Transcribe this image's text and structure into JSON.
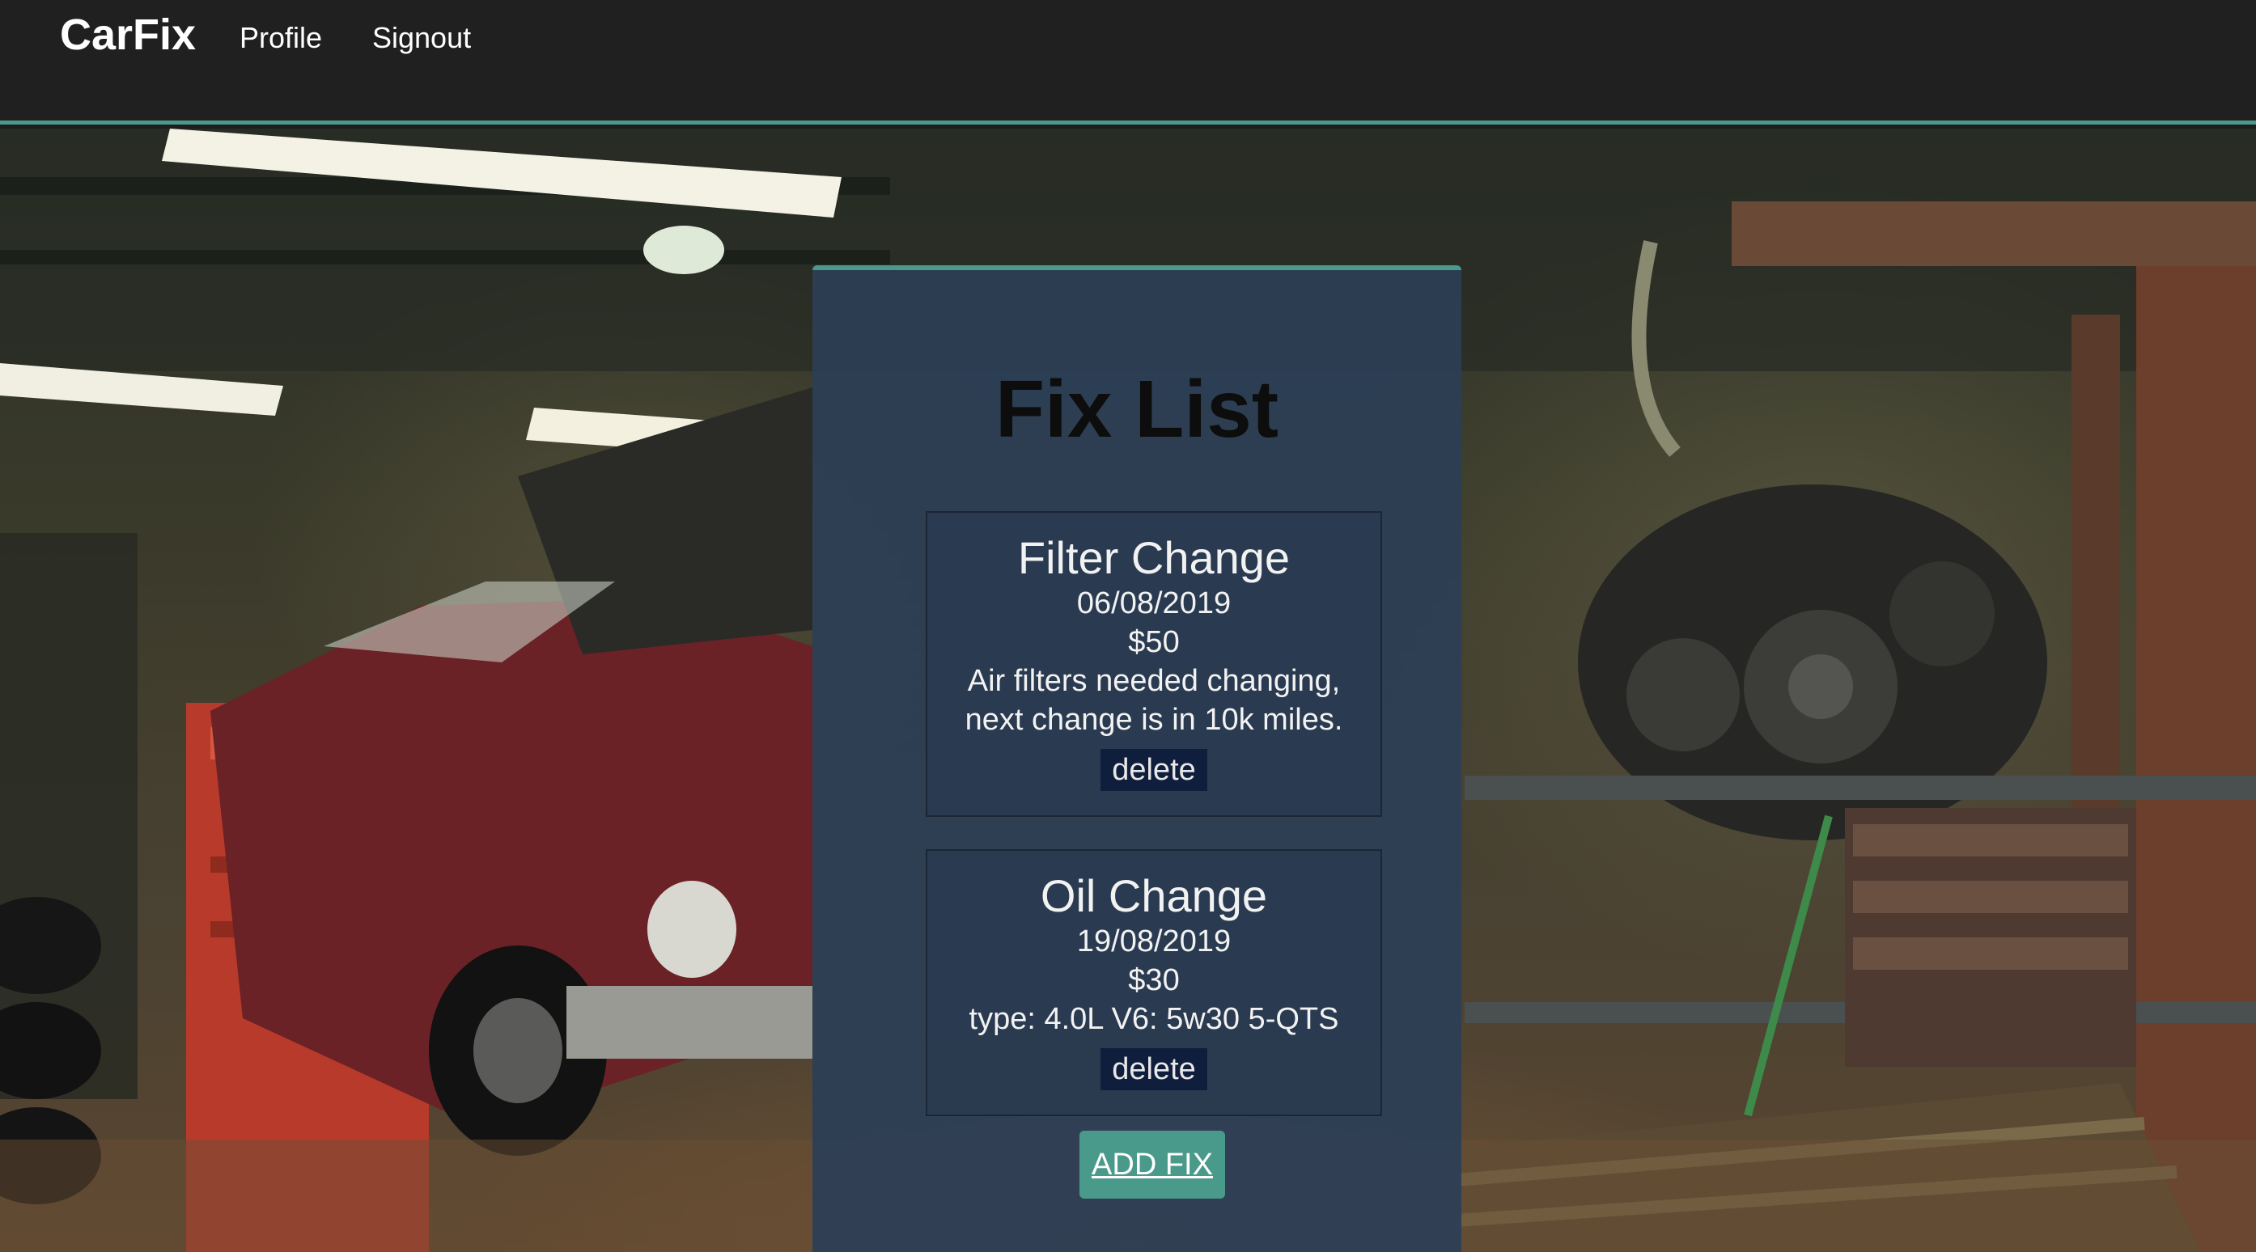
{
  "app": {
    "brand": "CarFix"
  },
  "nav": {
    "profile": "Profile",
    "signout": "Signout"
  },
  "main": {
    "title": "Fix List",
    "fixes": [
      {
        "name": "Filter Change",
        "date": "06/08/2019",
        "cost": "$50",
        "description": "Air filters needed changing, next change is in 10k miles.",
        "delete_label": "delete"
      },
      {
        "name": "Oil Change",
        "date": "19/08/2019",
        "cost": "$30",
        "description": "type: 4.0L V6: 5w30 5-QTS",
        "delete_label": "delete"
      }
    ],
    "add_label": "ADD FIX"
  },
  "colors": {
    "navbar": "#202020",
    "accent": "#4a9a8c",
    "panel": "#2c3e56",
    "delete_button": "#0f1e3c"
  },
  "icons": {
    "background": "garage-photo"
  }
}
